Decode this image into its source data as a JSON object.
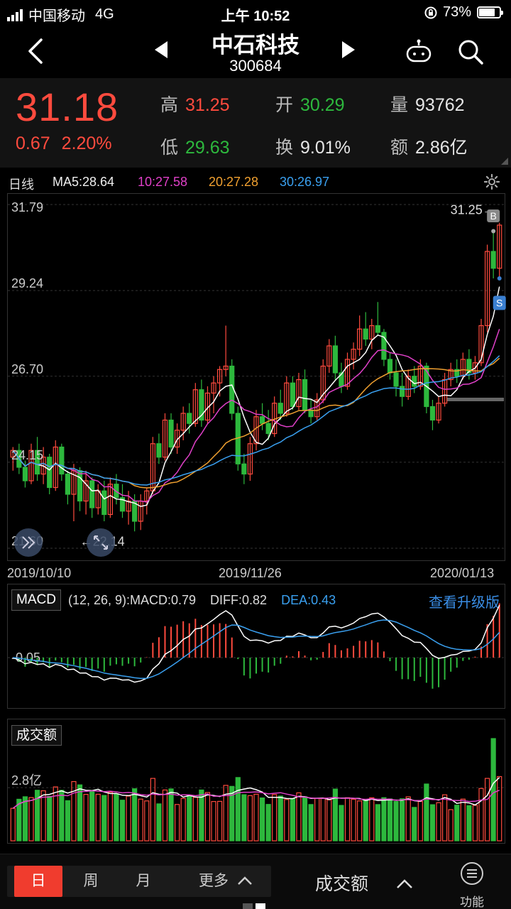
{
  "status": {
    "carrier": "中国移动",
    "network": "4G",
    "time": "上午 10:52",
    "battery": "73%"
  },
  "nav": {
    "title": "中石科技",
    "code": "300684"
  },
  "quote": {
    "price": "31.18",
    "change": "0.67",
    "change_pct": "2.20%",
    "high_label": "高",
    "high": "31.25",
    "low_label": "低",
    "low": "29.63",
    "open_label": "开",
    "open": "30.29",
    "turnover_label": "换",
    "turnover": "9.01%",
    "volume_label": "量",
    "volume": "93762",
    "amount_label": "额",
    "amount": "2.86亿"
  },
  "ma_bar": {
    "period": "日线",
    "ma5": "MA5:28.64",
    "ma10": "10:27.58",
    "ma20": "20:27.28",
    "ma30": "30:26.97"
  },
  "colors": {
    "up": "#ff4b3e",
    "down": "#2db83d",
    "ma5": "#ffffff",
    "ma10": "#e040c8",
    "ma20": "#f0a030",
    "ma30": "#3aa0f0",
    "accent": "#f03c2e"
  },
  "kline": {
    "y_labels": [
      "31.79",
      "29.24",
      "26.70",
      "24.15",
      "21.60"
    ],
    "high_marker": "31.25→",
    "low_marker": "←22.14",
    "buy_marker": "B",
    "sell_marker": "S",
    "dates": [
      "2019/10/10",
      "2019/11/26",
      "2020/01/13"
    ]
  },
  "macd": {
    "name": "MACD",
    "params": "(12, 26, 9):MACD:0.79",
    "diff": "DIFF:0.82",
    "dea": "DEA:0.43",
    "upgrade": "查看升级版",
    "axis_label": "-0.05"
  },
  "volume": {
    "name": "成交额",
    "axis_label": "2.8亿"
  },
  "bottom": {
    "periods": [
      "日",
      "周",
      "月",
      "更多"
    ],
    "indicator": "成交额",
    "func": "功能"
  },
  "chart_data": [
    {
      "type": "candlestick",
      "title": "日线",
      "x_range": [
        "2019/10/10",
        "2020/01/13"
      ],
      "ylim": [
        21.6,
        31.79
      ],
      "y_ticks": [
        31.79,
        29.24,
        26.7,
        24.15,
        21.6
      ],
      "ohlc": [
        [
          24.3,
          24.6,
          23.9,
          24.5
        ],
        [
          24.5,
          24.7,
          23.8,
          24.0
        ],
        [
          24.0,
          24.2,
          23.4,
          23.6
        ],
        [
          23.6,
          24.7,
          23.5,
          24.5
        ],
        [
          24.5,
          24.9,
          23.6,
          23.8
        ],
        [
          23.8,
          24.6,
          23.5,
          24.3
        ],
        [
          24.3,
          24.4,
          23.2,
          23.4
        ],
        [
          23.4,
          24.8,
          23.3,
          24.6
        ],
        [
          24.6,
          24.7,
          23.6,
          23.8
        ],
        [
          23.8,
          23.9,
          22.9,
          23.2
        ],
        [
          23.2,
          24.1,
          22.4,
          23.9
        ],
        [
          23.9,
          24.0,
          22.7,
          23.0
        ],
        [
          23.0,
          23.9,
          22.6,
          23.6
        ],
        [
          23.6,
          23.7,
          22.5,
          22.8
        ],
        [
          22.8,
          23.5,
          22.6,
          23.3
        ],
        [
          23.3,
          23.6,
          22.4,
          22.6
        ],
        [
          22.6,
          23.7,
          22.5,
          23.5
        ],
        [
          23.5,
          23.8,
          22.9,
          23.1
        ],
        [
          23.1,
          23.5,
          22.5,
          22.7
        ],
        [
          22.7,
          23.3,
          22.3,
          23.0
        ],
        [
          23.0,
          23.2,
          22.1,
          22.4
        ],
        [
          22.4,
          23.2,
          22.14,
          23.0
        ],
        [
          23.0,
          23.4,
          22.6,
          23.3
        ],
        [
          23.3,
          24.9,
          23.2,
          24.7
        ],
        [
          24.7,
          25.0,
          24.1,
          24.3
        ],
        [
          24.3,
          25.6,
          24.2,
          25.4
        ],
        [
          25.4,
          25.6,
          24.4,
          24.6
        ],
        [
          24.6,
          25.3,
          24.4,
          25.1
        ],
        [
          25.1,
          25.8,
          24.8,
          25.6
        ],
        [
          25.6,
          25.9,
          25.0,
          25.3
        ],
        [
          25.3,
          26.5,
          25.2,
          26.3
        ],
        [
          26.3,
          26.6,
          25.2,
          25.4
        ],
        [
          25.4,
          26.4,
          25.3,
          26.2
        ],
        [
          26.2,
          26.7,
          25.6,
          26.5
        ],
        [
          26.5,
          27.0,
          26.1,
          26.9
        ],
        [
          26.9,
          28.2,
          26.7,
          27.0
        ],
        [
          27.0,
          27.2,
          25.4,
          25.6
        ],
        [
          25.6,
          25.8,
          23.9,
          24.1
        ],
        [
          24.1,
          24.4,
          23.5,
          23.8
        ],
        [
          23.8,
          24.9,
          23.6,
          24.7
        ],
        [
          24.7,
          25.7,
          24.5,
          25.5
        ],
        [
          25.5,
          25.9,
          25.1,
          25.3
        ],
        [
          25.3,
          25.7,
          24.8,
          25.0
        ],
        [
          25.0,
          26.1,
          24.9,
          25.9
        ],
        [
          25.9,
          26.3,
          25.4,
          25.6
        ],
        [
          25.6,
          26.7,
          25.5,
          26.5
        ],
        [
          26.5,
          26.7,
          25.7,
          25.8
        ],
        [
          25.8,
          26.8,
          25.7,
          26.6
        ],
        [
          26.6,
          26.9,
          25.6,
          25.7
        ],
        [
          25.7,
          26.0,
          25.3,
          25.5
        ],
        [
          25.5,
          26.2,
          25.4,
          26.0
        ],
        [
          26.0,
          27.2,
          25.9,
          27.0
        ],
        [
          27.0,
          27.8,
          26.8,
          27.6
        ],
        [
          27.6,
          27.9,
          26.6,
          26.8
        ],
        [
          26.8,
          27.1,
          26.2,
          26.4
        ],
        [
          26.4,
          27.4,
          26.3,
          27.2
        ],
        [
          27.2,
          27.7,
          26.9,
          27.5
        ],
        [
          27.5,
          28.5,
          27.3,
          28.1
        ],
        [
          28.1,
          28.6,
          27.6,
          27.8
        ],
        [
          27.8,
          28.4,
          27.5,
          28.2
        ],
        [
          28.2,
          28.9,
          27.9,
          28.0
        ],
        [
          28.0,
          28.1,
          27.0,
          27.2
        ],
        [
          27.2,
          27.4,
          26.6,
          26.8
        ],
        [
          26.8,
          27.2,
          26.1,
          26.4
        ],
        [
          26.4,
          26.8,
          25.8,
          26.1
        ],
        [
          26.1,
          26.9,
          26.0,
          26.7
        ],
        [
          26.7,
          27.0,
          26.2,
          26.4
        ],
        [
          26.4,
          27.2,
          26.3,
          27.0
        ],
        [
          27.0,
          27.1,
          25.6,
          25.8
        ],
        [
          25.8,
          26.0,
          25.1,
          25.4
        ],
        [
          25.4,
          26.1,
          25.3,
          25.9
        ],
        [
          25.9,
          26.8,
          25.8,
          26.6
        ],
        [
          26.6,
          27.1,
          26.4,
          26.9
        ],
        [
          26.9,
          27.2,
          26.5,
          26.7
        ],
        [
          26.7,
          27.4,
          26.6,
          27.2
        ],
        [
          27.2,
          27.5,
          26.6,
          26.8
        ],
        [
          26.8,
          27.3,
          26.6,
          27.1
        ],
        [
          27.1,
          28.4,
          27.0,
          28.2
        ],
        [
          28.2,
          30.6,
          28.0,
          30.4
        ],
        [
          30.4,
          31.0,
          29.6,
          29.9
        ],
        [
          29.9,
          31.25,
          29.63,
          31.18
        ]
      ]
    },
    {
      "type": "line",
      "title": "MACD",
      "series": [
        {
          "name": "DIFF",
          "last": 0.82
        },
        {
          "name": "DEA",
          "last": 0.43
        },
        {
          "name": "MACD",
          "last": 0.79
        }
      ]
    },
    {
      "type": "bar",
      "title": "成交额",
      "y_ticks": [
        "2.8亿"
      ]
    }
  ]
}
